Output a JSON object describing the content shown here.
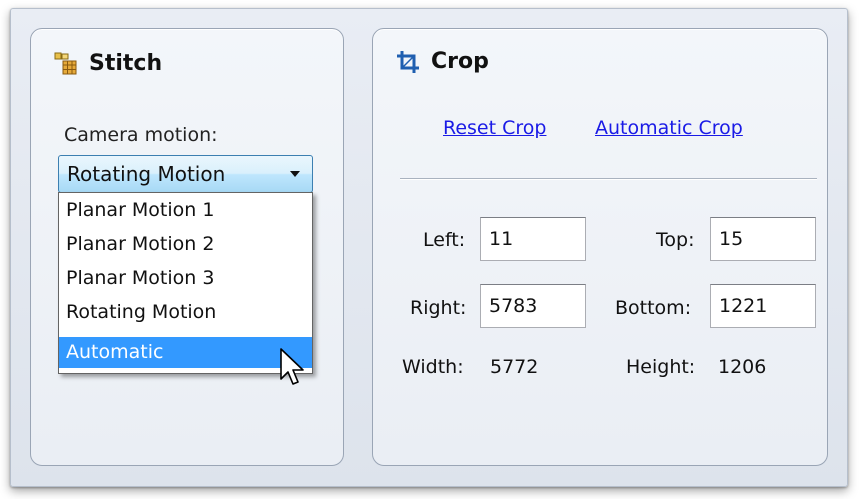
{
  "stitch": {
    "title": "Stitch",
    "icon": "stitch-icon",
    "camera_motion_label": "Camera motion:",
    "selected": "Rotating Motion",
    "options": [
      "Planar Motion 1",
      "Planar Motion 2",
      "Planar Motion 3",
      "Rotating Motion",
      "Automatic"
    ],
    "highlighted_option": "Automatic"
  },
  "crop": {
    "title": "Crop",
    "icon": "crop-icon",
    "reset_link": "Reset Crop",
    "auto_link": "Automatic Crop",
    "left_label": "Left:",
    "left_value": "11",
    "top_label": "Top:",
    "top_value": "15",
    "right_label": "Right:",
    "right_value": "5783",
    "bottom_label": "Bottom:",
    "bottom_value": "1221",
    "width_label": "Width:",
    "width_value": "5772",
    "height_label": "Height:",
    "height_value": "1206"
  },
  "colors": {
    "accent": "#3399ff",
    "link": "#1a1ae6",
    "crop_icon": "#1f5fb0"
  }
}
